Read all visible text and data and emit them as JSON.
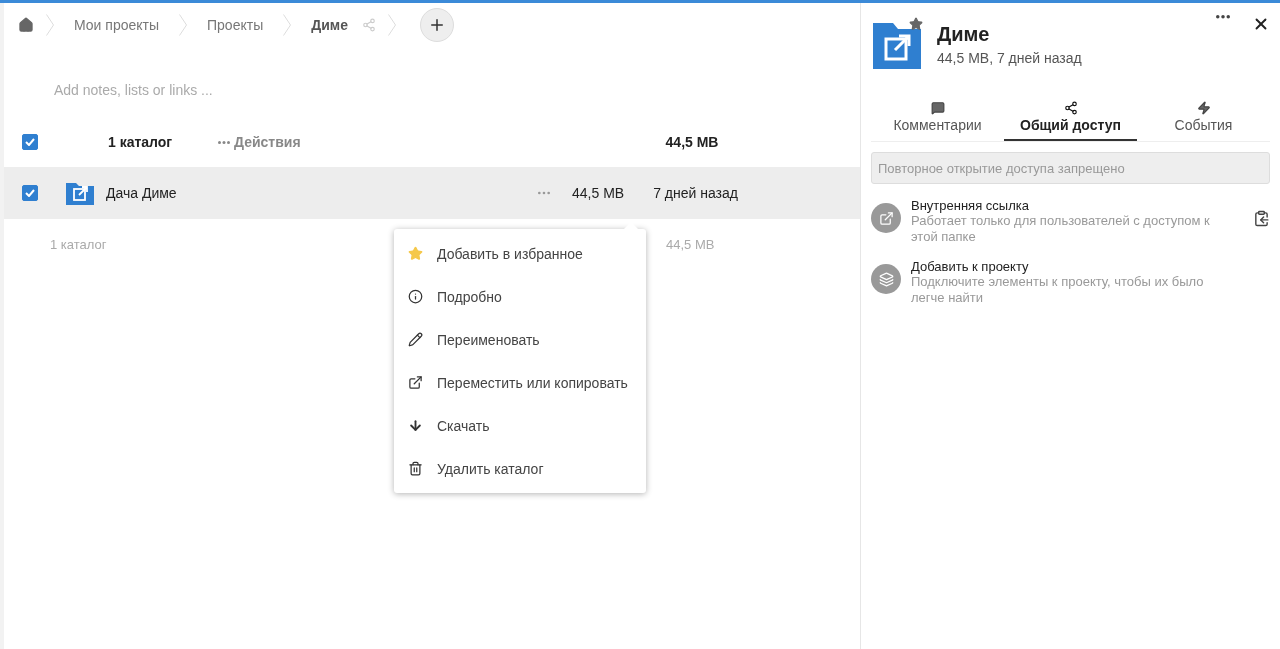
{
  "breadcrumbs": [
    {
      "label": "Мои проекты",
      "current": false
    },
    {
      "label": "Проекты",
      "current": false
    },
    {
      "label": "Диме",
      "current": true
    }
  ],
  "notes": {
    "placeholder": "Add notes, lists or links ..."
  },
  "list_header": {
    "checked": true,
    "count": "1 каталог",
    "actions": "Действия",
    "size": "44,5 MB"
  },
  "rows": [
    {
      "name": "Дача Диме",
      "checked": true,
      "selected": true,
      "size": "44,5 MB",
      "modified": "7 дней назад"
    }
  ],
  "summary": {
    "count": "1 каталог",
    "size": "44,5 MB"
  },
  "menu": [
    {
      "kind": "star",
      "label": "Добавить в избранное"
    },
    {
      "kind": "info",
      "label": "Подробно"
    },
    {
      "kind": "rename",
      "label": "Переименовать"
    },
    {
      "kind": "move",
      "label": "Переместить или копировать"
    },
    {
      "kind": "download",
      "label": "Скачать"
    },
    {
      "kind": "delete",
      "label": "Удалить каталог"
    }
  ],
  "sidebar": {
    "title": "Диме",
    "favorite": true,
    "meta": "44,5 MB, 7 дней назад",
    "tabs": [
      {
        "kind": "comments",
        "label": "Комментарии",
        "selected": false
      },
      {
        "kind": "share",
        "label": "Общий доступ",
        "selected": true
      },
      {
        "kind": "activity",
        "label": "События",
        "selected": false
      }
    ],
    "share_field": {
      "placeholder": "Повторное открытие доступа запрещено"
    },
    "entries": [
      {
        "kind": "link",
        "title": "Внутренняя ссылка",
        "description": "Работает только для пользователей с доступом к этой папке"
      },
      {
        "kind": "project",
        "title": "Добавить к проекту",
        "description": "Подключите элементы к проекту, чтобы их было легче найти"
      }
    ]
  }
}
